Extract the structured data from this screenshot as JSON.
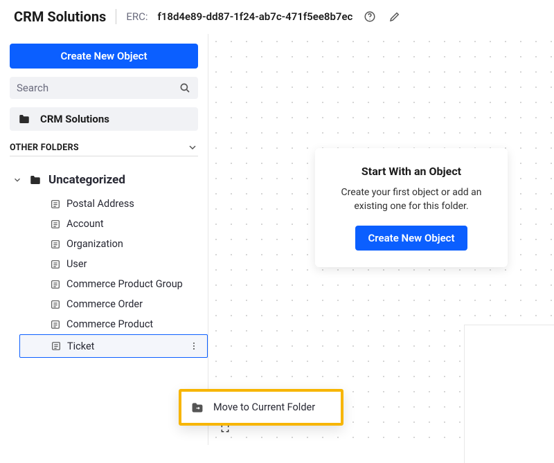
{
  "header": {
    "title": "CRM Solutions",
    "erc_label": "ERC:",
    "erc_value": "f18d4e89-dd87-1f24-ab7c-471f5ee8b7ec"
  },
  "sidebar": {
    "create_button": "Create New Object",
    "search_placeholder": "Search",
    "current_folder": "CRM Solutions",
    "other_folders_label": "OTHER FOLDERS",
    "tree": {
      "folder_name": "Uncategorized",
      "items": [
        "Postal Address",
        "Account",
        "Organization",
        "User",
        "Commerce Product Group",
        "Commerce Order",
        "Commerce Product",
        "Ticket"
      ],
      "selected_index": 7
    }
  },
  "canvas": {
    "start_card": {
      "title": "Start With an Object",
      "body": "Create your first object or add an existing one for this folder.",
      "button": "Create New Object"
    }
  },
  "context_menu": {
    "label": "Move to Current Folder"
  }
}
